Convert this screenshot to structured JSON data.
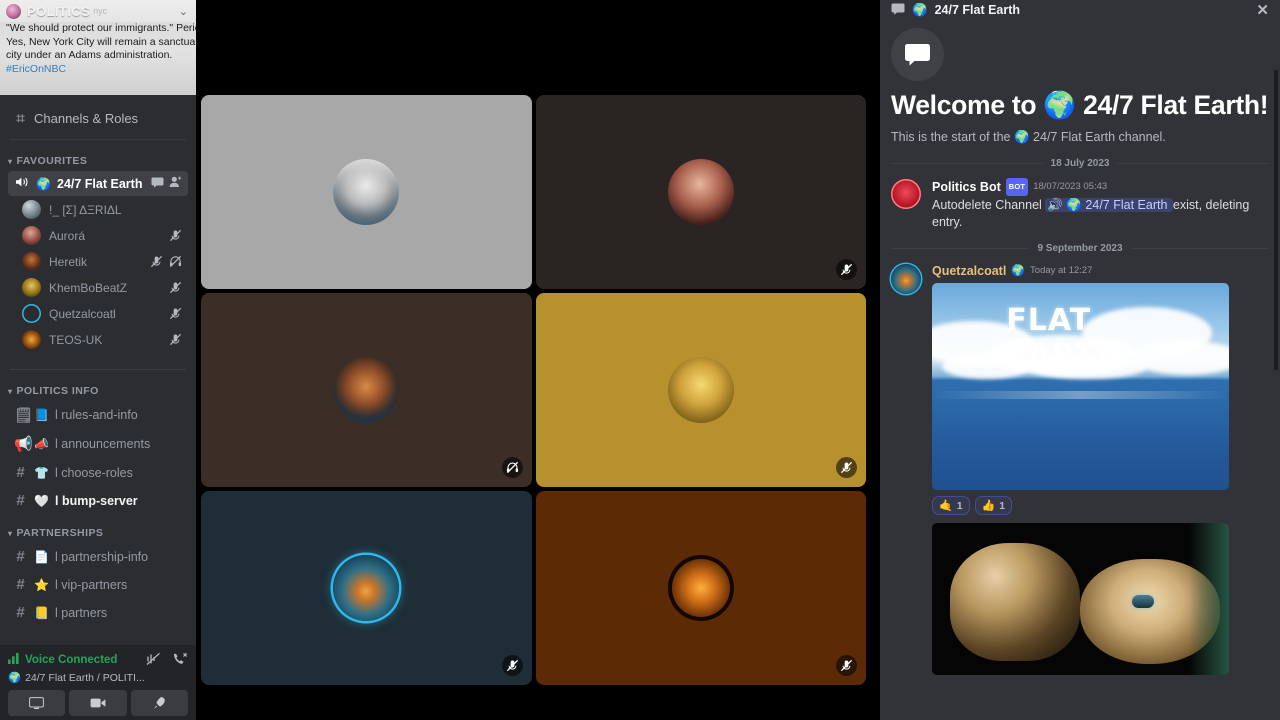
{
  "server": {
    "name": "POLITICS",
    "subtitle": "nyc",
    "chevron_icon": "chevron-down-icon",
    "banner_lines": [
      "\"We should protect our immigrants.\" Period.",
      "",
      "Yes, New York City will remain a sanctuary",
      "city under an Adams administration."
    ],
    "banner_hashtag": "#EricOnNBC"
  },
  "sidebar": {
    "channels_and_roles": "Channels & Roles",
    "categories": [
      {
        "label": "FAVOURITES",
        "collapsed": false,
        "channels": [
          {
            "name": "24/7 Flat Earth",
            "icon": "speaker-icon",
            "emoji": "🌍",
            "active": true,
            "trailing_icons": [
              "chat-icon",
              "invite-person-icon"
            ]
          }
        ],
        "voice_members": [
          {
            "name": "!_ [Σ] ΔΞRIΔL",
            "muted": false,
            "deafened": false
          },
          {
            "name": "Aurorá",
            "muted": true,
            "deafened": false
          },
          {
            "name": "Heretik",
            "muted": true,
            "deafened": true
          },
          {
            "name": "KhemBoBeatZ",
            "muted": true,
            "deafened": false
          },
          {
            "name": "Quetzalcoatl",
            "muted": true,
            "deafened": false
          },
          {
            "name": "TEOS-UK",
            "muted": true,
            "deafened": false
          }
        ]
      },
      {
        "label": "POLITICS INFO",
        "collapsed": false,
        "channels": [
          {
            "name": "l rules-and-info",
            "icon": "note-icon",
            "emoji": "📘",
            "active": false
          },
          {
            "name": "l announcements",
            "icon": "megaphone-icon",
            "emoji": "📣",
            "active": false
          },
          {
            "name": "l choose-roles",
            "icon": "hash-icon",
            "emoji": "👕",
            "active": false
          },
          {
            "name": "l bump-server",
            "icon": "hash-icon",
            "emoji": "🤍",
            "active": false,
            "unread": true
          }
        ]
      },
      {
        "label": "PARTNERSHIPS",
        "collapsed": false,
        "channels": [
          {
            "name": "l partnership-info",
            "icon": "hash-icon",
            "emoji": "📄",
            "active": false
          },
          {
            "name": "l vip-partners",
            "icon": "hash-icon",
            "emoji": "⭐",
            "active": false
          },
          {
            "name": "l partners",
            "icon": "hash-icon",
            "emoji": "📒",
            "active": false
          }
        ]
      }
    ],
    "voice_panel": {
      "status": "Voice Connected",
      "signal_icon": "signal-bars-icon",
      "channel_line": "24/7 Flat Earth / POLITI...",
      "channel_emoji": "🌍",
      "noise_icon": "noise-suppression-icon",
      "disconnect_icon": "phone-hangup-icon",
      "buttons": [
        "screen-share-icon",
        "video-camera-icon",
        "activity-rocket-icon"
      ]
    }
  },
  "stage": {
    "tiles": [
      {
        "id": "tile-1",
        "bg": "#a8a8a8",
        "avatar": "trump-avatar",
        "muted": false,
        "deafened": false
      },
      {
        "id": "tile-2",
        "bg": "#2a2523",
        "avatar": "aurora-avatar",
        "muted": true,
        "deafened": false
      },
      {
        "id": "tile-3",
        "bg": "#3b2e26",
        "avatar": "heretik-avatar",
        "muted": true,
        "deafened": true
      },
      {
        "id": "tile-4",
        "bg": "#b8912f",
        "avatar": "khembobeatz-avatar",
        "muted": true,
        "deafened": false
      },
      {
        "id": "tile-5",
        "bg": "#1f2d36",
        "avatar": "quetzalcoatl-avatar",
        "muted": true,
        "deafened": false
      },
      {
        "id": "tile-6",
        "bg": "#5c2a05",
        "avatar": "teos-uk-avatar",
        "muted": true,
        "deafened": false
      }
    ]
  },
  "chat": {
    "header": {
      "title": "24/7 Flat Earth",
      "emoji": "🌍",
      "icon": "chat-bubble-icon",
      "close_icon": "close-icon"
    },
    "welcome": {
      "title_prefix": "Welcome to",
      "emoji": "🌍",
      "title_suffix": "24/7 Flat Earth!",
      "subtitle_prefix": "This is the start of the",
      "subtitle_suffix": "24/7 Flat Earth channel."
    },
    "day_separator_1": "18 July 2023",
    "day_separator_2": "9 September 2023",
    "messages": [
      {
        "author": "Politics Bot",
        "author_color": "#ffffff",
        "bot_badge": "BOT",
        "timestamp": "18/07/2023 05:43",
        "text_before": "Autodelete Channel",
        "mention": "24/7 Flat Earth",
        "mention_emoji": "🌍",
        "mention_speaker_icon": "speaker-icon",
        "text_after": "exist, deleting entry."
      },
      {
        "author": "Quetzalcoatl",
        "author_color": "#e5c07b",
        "author_emoji": "🌍",
        "timestamp": "Today at 12:27",
        "attachment_1": {
          "name": "flat-earth-ocean-image",
          "caption": "FLAT EARTH"
        },
        "reactions": [
          {
            "emoji": "🤙",
            "count": "1"
          },
          {
            "emoji": "👍",
            "count": "1"
          }
        ],
        "attachment_2": {
          "name": "matrix-red-blue-pill-image"
        }
      }
    ]
  },
  "colors": {
    "accent": "#5865f2",
    "online_green": "#23a55a",
    "sidebar_bg": "#2b2d31",
    "chat_bg": "#313338",
    "stage_bg": "#000000"
  }
}
